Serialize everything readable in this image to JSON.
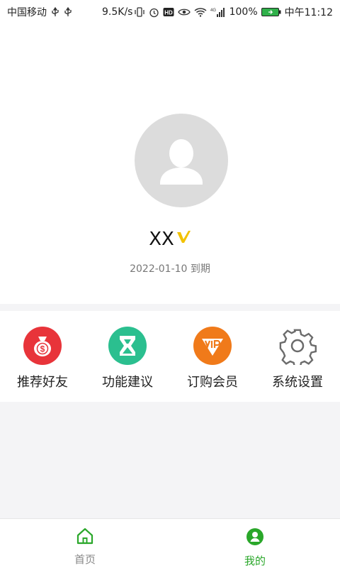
{
  "status_bar": {
    "carrier": "中国移动",
    "speed": "9.5K/s",
    "network": "4G",
    "battery": "100%",
    "time": "中午11:12"
  },
  "profile": {
    "name": "XX",
    "vip_badge_icon": "vip-v-icon",
    "expire_text": "2022-01-10 到期"
  },
  "menu": {
    "items": [
      {
        "label": "推荐好友",
        "icon": "money-bag-icon",
        "color": "#e8343a"
      },
      {
        "label": "功能建议",
        "icon": "suggestion-icon",
        "color": "#2bbf8f"
      },
      {
        "label": "订购会员",
        "icon": "vip-shield-icon",
        "color": "#f07a1a"
      },
      {
        "label": "系统设置",
        "icon": "gear-icon",
        "color": "#6b6b6b"
      }
    ]
  },
  "bottom_nav": {
    "items": [
      {
        "label": "首页",
        "icon": "home-icon",
        "active": false
      },
      {
        "label": "我的",
        "icon": "user-icon",
        "active": true
      }
    ],
    "active_color": "#2aa72a",
    "inactive_color": "#888888"
  }
}
